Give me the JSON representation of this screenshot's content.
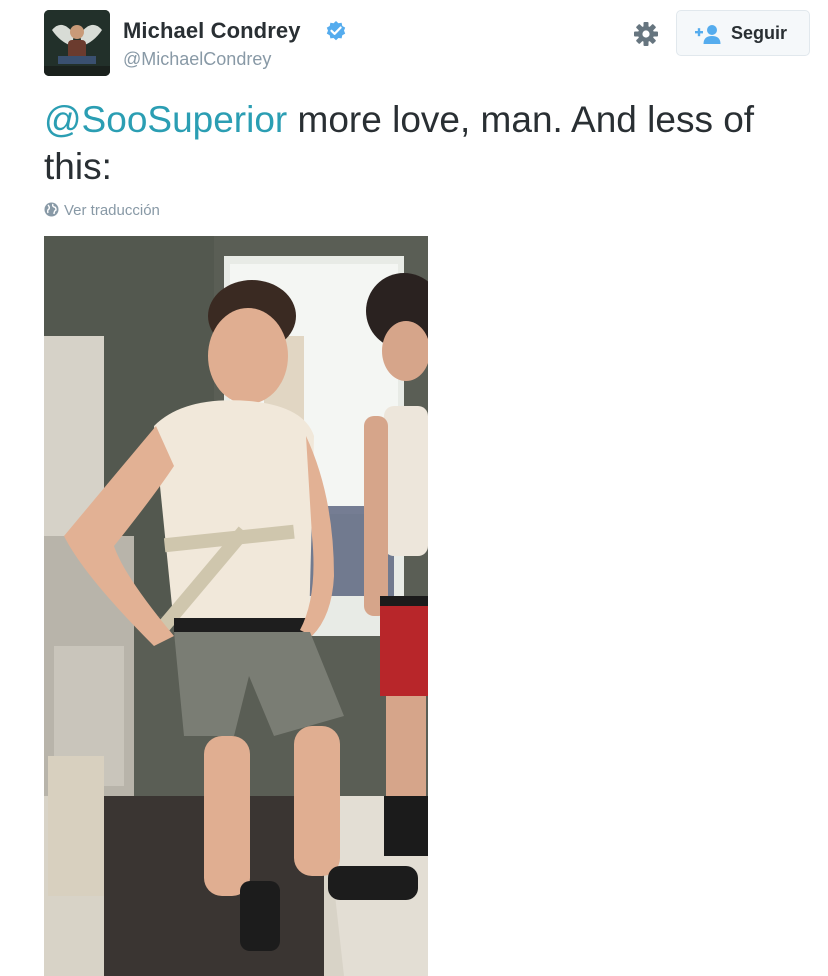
{
  "author": {
    "name": "Michael Condrey",
    "handle": "@MichaelCondrey",
    "verified": true
  },
  "actions": {
    "settings_icon": "gear-icon",
    "follow_icon": "add-user-icon",
    "follow_label": "Seguir"
  },
  "tweet": {
    "mention": "@SooSuperior",
    "text": " more love, man. And less of this:",
    "translate_icon": "globe-icon",
    "translate_label": "Ver traducción"
  },
  "colors": {
    "accent": "#2b9eb3",
    "verified": "#55acee",
    "muted": "#8899a6",
    "text": "#292f33"
  }
}
